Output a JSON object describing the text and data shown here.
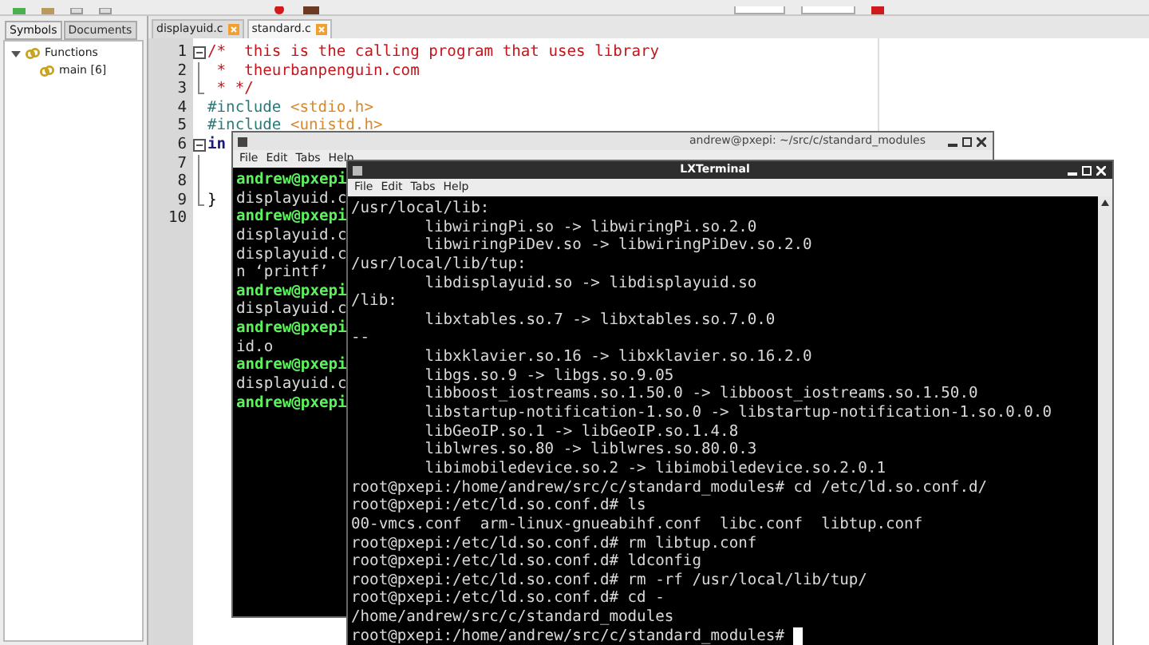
{
  "editor": {
    "sidebar_tabs": [
      {
        "label": "Symbols",
        "selected": true
      },
      {
        "label": "Documents",
        "selected": false
      }
    ],
    "symbols": [
      {
        "label": "Functions",
        "expanded": true,
        "children": [
          {
            "label": "main [6]"
          }
        ]
      }
    ],
    "tabs": [
      {
        "label": "displayuid.c",
        "selected": false
      },
      {
        "label": "standard.c",
        "selected": true
      }
    ],
    "lines": [
      {
        "number": "1",
        "fold_toggle": true,
        "in_fold": false,
        "tokens": [
          {
            "kind": "comment",
            "text": "/*  this is the calling program that uses library"
          }
        ]
      },
      {
        "number": "2",
        "fold_toggle": false,
        "in_fold": true,
        "tokens": [
          {
            "kind": "comment",
            "text": " *  theurbanpenguin.com"
          }
        ]
      },
      {
        "number": "3",
        "fold_toggle": false,
        "in_fold": true,
        "tokens": [
          {
            "kind": "comment",
            "text": " * */"
          }
        ]
      },
      {
        "number": "4",
        "fold_toggle": false,
        "in_fold": false,
        "tokens": [
          {
            "kind": "directive",
            "text": "#include "
          },
          {
            "kind": "header",
            "text": "<stdio.h>"
          }
        ]
      },
      {
        "number": "5",
        "fold_toggle": false,
        "in_fold": false,
        "tokens": [
          {
            "kind": "directive",
            "text": "#include "
          },
          {
            "kind": "header",
            "text": "<unistd.h>"
          }
        ]
      },
      {
        "number": "6",
        "fold_toggle": true,
        "in_fold": false,
        "tokens": [
          {
            "kind": "keyword",
            "text": "in"
          }
        ]
      },
      {
        "number": "7",
        "fold_toggle": false,
        "in_fold": true
      },
      {
        "number": "8",
        "fold_toggle": false,
        "in_fold": true
      },
      {
        "number": "9",
        "fold_toggle": false,
        "in_fold": true,
        "tokens": [
          {
            "kind": "plain",
            "text": "}"
          }
        ]
      },
      {
        "number": "10",
        "fold_toggle": false,
        "in_fold": false
      }
    ]
  },
  "terminals": [
    {
      "title": "andrew@pxepi: ~/src/c/standard_modules",
      "active": false,
      "menu": [
        "File",
        "Edit",
        "Tabs",
        "Help"
      ],
      "lines": [
        {
          "kind": "prompt",
          "text": "andrew@pxepi"
        },
        {
          "kind": "output",
          "text": "displayuid.c"
        },
        {
          "kind": "prompt",
          "text": "andrew@pxepi"
        },
        {
          "kind": "output",
          "text": "displayuid.c"
        },
        {
          "kind": "output",
          "text": "displayuid.c"
        },
        {
          "kind": "output",
          "text": "n ‘printf’"
        },
        {
          "kind": "prompt",
          "text": "andrew@pxepi"
        },
        {
          "kind": "output",
          "text": "displayuid.c"
        },
        {
          "kind": "prompt",
          "text": "andrew@pxepi"
        },
        {
          "kind": "output",
          "text": "id.o"
        },
        {
          "kind": "prompt",
          "text": "andrew@pxepi"
        },
        {
          "kind": "output",
          "text": "displayuid.c"
        },
        {
          "kind": "prompt",
          "text": "andrew@pxepi"
        }
      ]
    },
    {
      "title": "LXTerminal",
      "active": true,
      "cursor": true,
      "menu": [
        "File",
        "Edit",
        "Tabs",
        "Help"
      ],
      "lines": [
        {
          "kind": "output",
          "text": "/usr/local/lib:"
        },
        {
          "kind": "output",
          "text": "        libwiringPi.so -> libwiringPi.so.2.0"
        },
        {
          "kind": "output",
          "text": "        libwiringPiDev.so -> libwiringPiDev.so.2.0"
        },
        {
          "kind": "output",
          "text": "/usr/local/lib/tup:"
        },
        {
          "kind": "output",
          "text": "        libdisplayuid.so -> libdisplayuid.so"
        },
        {
          "kind": "output",
          "text": "/lib:"
        },
        {
          "kind": "output",
          "text": "        libxtables.so.7 -> libxtables.so.7.0.0"
        },
        {
          "kind": "output",
          "text": "--"
        },
        {
          "kind": "output",
          "text": "        libxklavier.so.16 -> libxklavier.so.16.2.0"
        },
        {
          "kind": "output",
          "text": "        libgs.so.9 -> libgs.so.9.05"
        },
        {
          "kind": "output",
          "text": "        libboost_iostreams.so.1.50.0 -> libboost_iostreams.so.1.50.0"
        },
        {
          "kind": "output",
          "text": "        libstartup-notification-1.so.0 -> libstartup-notification-1.so.0.0.0"
        },
        {
          "kind": "output",
          "text": "        libGeoIP.so.1 -> libGeoIP.so.1.4.8"
        },
        {
          "kind": "output",
          "text": "        liblwres.so.80 -> liblwres.so.80.0.3"
        },
        {
          "kind": "output",
          "text": "        libimobiledevice.so.2 -> libimobiledevice.so.2.0.1"
        },
        {
          "kind": "output",
          "text": "root@pxepi:/home/andrew/src/c/standard_modules# cd /etc/ld.so.conf.d/"
        },
        {
          "kind": "output",
          "text": "root@pxepi:/etc/ld.so.conf.d# ls"
        },
        {
          "kind": "output",
          "text": "00-vmcs.conf  arm-linux-gnueabihf.conf  libc.conf  libtup.conf"
        },
        {
          "kind": "output",
          "text": "root@pxepi:/etc/ld.so.conf.d# rm libtup.conf"
        },
        {
          "kind": "output",
          "text": "root@pxepi:/etc/ld.so.conf.d# ldconfig"
        },
        {
          "kind": "output",
          "text": "root@pxepi:/etc/ld.so.conf.d# rm -rf /usr/local/lib/tup/"
        },
        {
          "kind": "output",
          "text": "root@pxepi:/etc/ld.so.conf.d# cd -"
        },
        {
          "kind": "output",
          "text": "/home/andrew/src/c/standard_modules"
        },
        {
          "kind": "output",
          "text": "root@pxepi:/home/andrew/src/c/standard_modules# "
        }
      ]
    }
  ]
}
